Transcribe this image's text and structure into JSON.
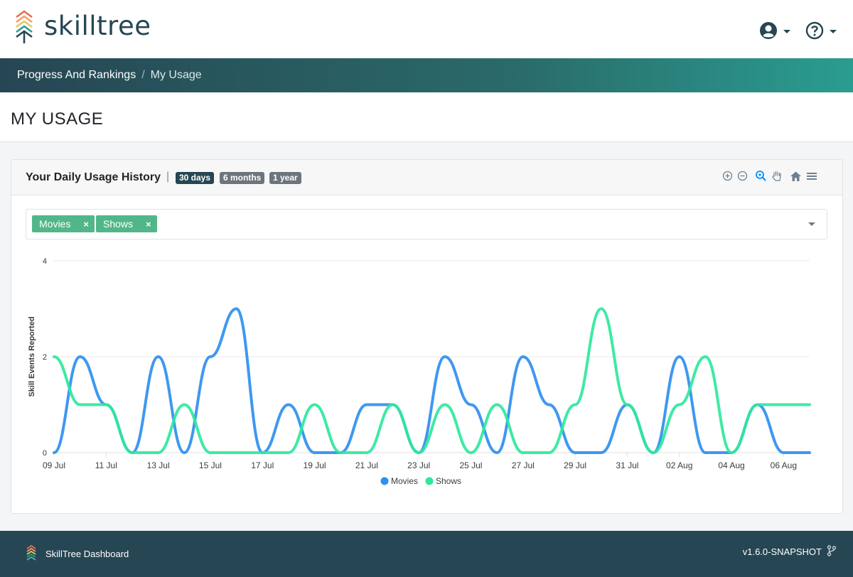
{
  "app": {
    "logo_text": "skilltree"
  },
  "breadcrumb": {
    "items": [
      "Progress And Rankings",
      "My Usage"
    ]
  },
  "page": {
    "title": "MY USAGE"
  },
  "card": {
    "title": "Your Daily Usage History",
    "ranges": [
      {
        "label": "30 days",
        "active": true
      },
      {
        "label": "6 months",
        "active": false
      },
      {
        "label": "1 year",
        "active": false
      }
    ],
    "tools": [
      "zoom-in-icon",
      "zoom-out-icon",
      "selection-zoom-icon",
      "pan-icon",
      "reset-home-icon",
      "menu-icon"
    ]
  },
  "filter": {
    "tags": [
      {
        "label": "Movies",
        "remove": "×"
      },
      {
        "label": "Shows",
        "remove": "×"
      }
    ]
  },
  "colors": {
    "movies": "#2f8ff0",
    "shows": "#2ee89c",
    "brand_dark": "#264653",
    "tag": "#52b788"
  },
  "chart_data": {
    "type": "line",
    "ylabel": "Skill Events Reported",
    "xlabel": "",
    "ylim": [
      0,
      4
    ],
    "yticks": [
      0,
      2,
      4
    ],
    "grid": true,
    "legend": "bottom-center",
    "x_tick_labels": [
      "09 Jul",
      "11 Jul",
      "13 Jul",
      "15 Jul",
      "17 Jul",
      "19 Jul",
      "21 Jul",
      "23 Jul",
      "25 Jul",
      "27 Jul",
      "29 Jul",
      "31 Jul",
      "02 Aug",
      "04 Aug",
      "06 Aug"
    ],
    "x": [
      "09 Jul",
      "10 Jul",
      "11 Jul",
      "12 Jul",
      "13 Jul",
      "14 Jul",
      "15 Jul",
      "16 Jul",
      "17 Jul",
      "18 Jul",
      "19 Jul",
      "20 Jul",
      "21 Jul",
      "22 Jul",
      "23 Jul",
      "24 Jul",
      "25 Jul",
      "26 Jul",
      "27 Jul",
      "28 Jul",
      "29 Jul",
      "30 Jul",
      "31 Jul",
      "01 Aug",
      "02 Aug",
      "03 Aug",
      "04 Aug",
      "05 Aug",
      "06 Aug",
      "07 Aug"
    ],
    "series": [
      {
        "name": "Movies",
        "values": [
          0,
          2,
          1,
          0,
          2,
          0,
          2,
          3,
          0,
          1,
          0,
          0,
          1,
          1,
          0,
          2,
          1,
          0,
          2,
          1,
          0,
          0,
          1,
          0,
          2,
          0,
          0,
          1,
          0,
          0
        ]
      },
      {
        "name": "Shows",
        "values": [
          2,
          1,
          1,
          0,
          0,
          1,
          0,
          0,
          0,
          0,
          1,
          0,
          0,
          1,
          0,
          1,
          0,
          1,
          0,
          0,
          1,
          3,
          1,
          0,
          1,
          2,
          0,
          1,
          1,
          1
        ]
      }
    ]
  },
  "footer": {
    "name": "SkillTree Dashboard",
    "version": "v1.6.0-SNAPSHOT"
  }
}
